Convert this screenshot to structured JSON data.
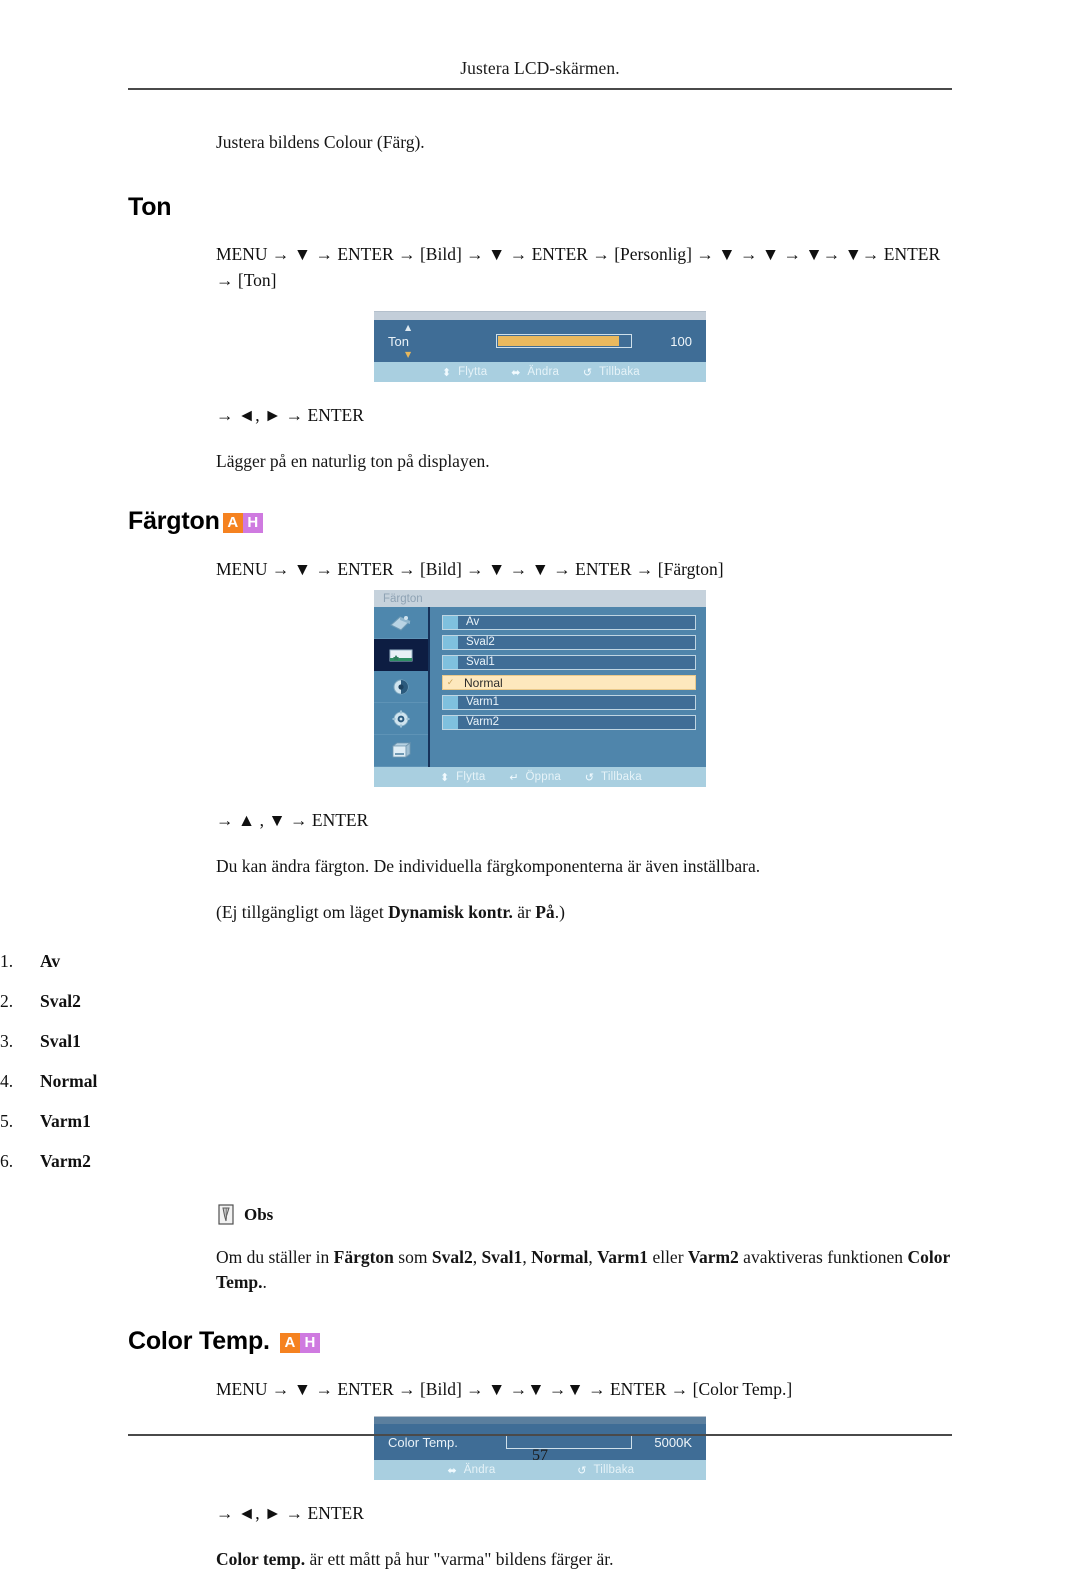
{
  "header": {
    "running_title": "Justera LCD-skärmen.",
    "page_number": "57"
  },
  "intro": {
    "text": "Justera bildens Colour (Färg)."
  },
  "badge": {
    "a_label": "A",
    "h_label": "H",
    "a_color": "#f58220",
    "h_color": "#cf7ae0"
  },
  "sections": {
    "ton": {
      "heading": "Ton",
      "nav_path": "MENU → ▼ → ENTER → [Bild] → ▼ → ENTER → [Personlig] → ▼ → ▼ → ▼→ ▼→ ENTER → [Ton]",
      "key_hint": "→ ◄, ► → ENTER",
      "description": "Lägger på en naturlig ton på displayen.",
      "osd": {
        "label": "Ton",
        "value": "100",
        "fill_percent": 92,
        "footer": [
          {
            "icon": "updown-arrow-icon",
            "glyph": "⬍",
            "label": "Flytta"
          },
          {
            "icon": "leftright-arrow-icon",
            "glyph": "⬌",
            "label": "Ändra"
          },
          {
            "icon": "return-arrow-icon",
            "glyph": "↺",
            "label": "Tillbaka"
          }
        ]
      }
    },
    "fargton": {
      "heading": "Färgton",
      "nav_path": "MENU → ▼ → ENTER → [Bild] → ▼ → ▼ → ENTER → [Färgton]",
      "key_hint": "→ ▲ , ▼ → ENTER",
      "description": "Du kan ändra färgton. De individuella färgkomponenterna är även inställbara.",
      "availability_note_pre": "(Ej tillgängligt om läget ",
      "availability_note_bold1": "Dynamisk kontr.",
      "availability_note_mid": " är ",
      "availability_note_bold2": "På",
      "availability_note_post": ".)",
      "osd": {
        "title": "Färgton",
        "icons": [
          {
            "name": "input-source-icon",
            "active": false
          },
          {
            "name": "picture-icon",
            "active": true
          },
          {
            "name": "sound-icon",
            "active": false
          },
          {
            "name": "setup-gear-icon",
            "active": false
          },
          {
            "name": "multi-control-icon",
            "active": false
          }
        ],
        "rows": [
          {
            "label": "Av",
            "selected": false
          },
          {
            "label": "Sval2",
            "selected": false
          },
          {
            "label": "Sval1",
            "selected": false
          },
          {
            "label": "Normal",
            "selected": true
          },
          {
            "label": "Varm1",
            "selected": false
          },
          {
            "label": "Varm2",
            "selected": false
          }
        ],
        "footer": [
          {
            "icon": "updown-arrow-icon",
            "glyph": "⬍",
            "label": "Flytta"
          },
          {
            "icon": "enter-key-icon",
            "glyph": "↵",
            "label": "Öppna"
          },
          {
            "icon": "return-arrow-icon",
            "glyph": "↺",
            "label": "Tillbaka"
          }
        ]
      },
      "options": [
        {
          "num": "1.",
          "label": "Av"
        },
        {
          "num": "2.",
          "label": "Sval2"
        },
        {
          "num": "3.",
          "label": "Sval1"
        },
        {
          "num": "4.",
          "label": "Normal"
        },
        {
          "num": "5.",
          "label": "Varm1"
        },
        {
          "num": "6.",
          "label": "Varm2"
        }
      ],
      "note": {
        "icon": "note-pencil-icon",
        "title": "Obs",
        "text_pre": "Om du ställer in ",
        "b1": "Färgton",
        "t1": " som ",
        "b2": "Sval2",
        "t2": ", ",
        "b3": "Sval1",
        "t3": ", ",
        "b4": "Normal",
        "t4": ", ",
        "b5": "Varm1",
        "t5": " eller ",
        "b6": "Varm2",
        "t6": " avaktiveras funktionen ",
        "b7": "Color Temp.",
        "t7": "."
      }
    },
    "colortemp": {
      "heading": "Color Temp.",
      "nav_path": "MENU → ▼ → ENTER → [Bild] → ▼ →▼ →▼ → ENTER → [Color Temp.]",
      "key_hint": "→ ◄, ► → ENTER",
      "description_bold": "Color temp.",
      "description_rest": " är ett mått på hur \"varma\" bildens färger är.",
      "osd": {
        "label": "Color  Temp.",
        "value": "5000K",
        "fill_percent": 0,
        "footer": [
          {
            "icon": "leftright-arrow-icon",
            "glyph": "⬌",
            "label": "Ändra"
          },
          {
            "icon": "return-arrow-icon",
            "glyph": "↺",
            "label": "Tillbaka"
          }
        ]
      }
    }
  }
}
